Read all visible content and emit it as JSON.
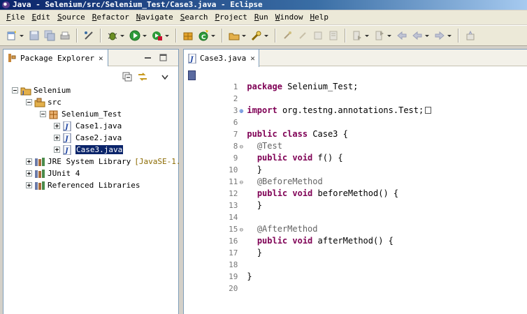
{
  "window": {
    "title": "Java - Selenium/src/Selenium_Test/Case3.java - Eclipse"
  },
  "menu": [
    "File",
    "Edit",
    "Source",
    "Refactor",
    "Navigate",
    "Search",
    "Project",
    "Run",
    "Window",
    "Help"
  ],
  "toolbar": {
    "icons": [
      "new-wizard-icon",
      "save-icon",
      "save-all-icon",
      "print-icon",
      "toggle-breadcrumb-icon",
      "debug-icon",
      "run-icon",
      "external-tools-icon",
      "new-java-project-icon",
      "new-class-icon",
      "open-type-icon",
      "search-icon",
      "annotation-next-icon",
      "annotation-prev-icon",
      "back-icon",
      "forward-icon",
      "pin-editor-icon"
    ]
  },
  "package_explorer": {
    "title": "Package Explorer",
    "tree": [
      {
        "label": "Selenium",
        "level": 0,
        "icon": "java-project-icon",
        "expanded": true
      },
      {
        "label": "src",
        "level": 1,
        "icon": "source-folder-icon",
        "expanded": true
      },
      {
        "label": "Selenium_Test",
        "level": 2,
        "icon": "package-icon",
        "expanded": true
      },
      {
        "label": "Case1.java",
        "level": 3,
        "icon": "java-file-icon",
        "expanded": false
      },
      {
        "label": "Case2.java",
        "level": 3,
        "icon": "java-file-icon",
        "expanded": false
      },
      {
        "label": "Case3.java",
        "level": 3,
        "icon": "java-file-icon",
        "expanded": false,
        "selected": true
      },
      {
        "label": "JRE System Library",
        "decoration": "[JavaSE-1.",
        "level": 1,
        "icon": "library-icon",
        "expanded": false
      },
      {
        "label": "JUnit 4",
        "level": 1,
        "icon": "library-icon",
        "expanded": false
      },
      {
        "label": "Referenced Libraries",
        "level": 1,
        "icon": "library-icon",
        "expanded": false
      }
    ]
  },
  "editor": {
    "tab_label": "Case3.java",
    "lines": [
      {
        "n": "1",
        "text": "package Selenium_Test;"
      },
      {
        "n": "2",
        "text": ""
      },
      {
        "n": "3",
        "text": "import org.testng.annotations.Test;",
        "fold": "plus"
      },
      {
        "n": "6",
        "text": ""
      },
      {
        "n": "7",
        "text": "public class Case3 {"
      },
      {
        "n": "8",
        "text": "  @Test",
        "fold": "minus"
      },
      {
        "n": "9",
        "text": "  public void f() {"
      },
      {
        "n": "10",
        "text": "  }"
      },
      {
        "n": "11",
        "text": "  @BeforeMethod",
        "fold": "minus"
      },
      {
        "n": "12",
        "text": "  public void beforeMethod() {"
      },
      {
        "n": "13",
        "text": "  }"
      },
      {
        "n": "14",
        "text": ""
      },
      {
        "n": "15",
        "text": "  @AfterMethod",
        "fold": "minus"
      },
      {
        "n": "16",
        "text": "  public void afterMethod() {"
      },
      {
        "n": "17",
        "text": "  }"
      },
      {
        "n": "18",
        "text": ""
      },
      {
        "n": "19",
        "text": "}"
      },
      {
        "n": "20",
        "text": ""
      }
    ]
  },
  "colors": {
    "keyword": "#7f0055",
    "annotation": "#646464",
    "selection": "#0a246a",
    "title_bar": "#0a246a"
  }
}
